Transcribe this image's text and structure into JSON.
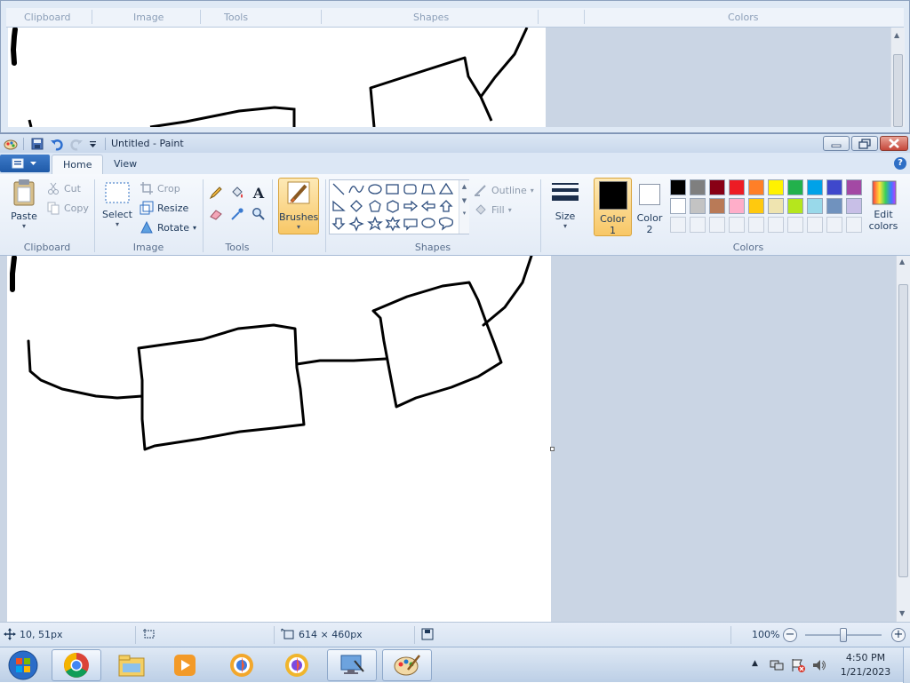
{
  "background_window": {
    "group_labels": [
      "Clipboard",
      "Image",
      "Tools",
      "Shapes",
      "Colors"
    ]
  },
  "window": {
    "title": "Untitled - Paint",
    "tabs": [
      "Home",
      "View"
    ],
    "help": "?"
  },
  "ribbon": {
    "clipboard": {
      "paste": "Paste",
      "cut": "Cut",
      "copy": "Copy",
      "label": "Clipboard"
    },
    "image": {
      "select": "Select",
      "crop": "Crop",
      "resize": "Resize",
      "rotate": "Rotate",
      "label": "Image"
    },
    "tools": {
      "label": "Tools",
      "text_tool": "A"
    },
    "brushes": {
      "label": "Brushes"
    },
    "shapes": {
      "outline": "Outline",
      "fill": "Fill",
      "label": "Shapes"
    },
    "size": {
      "label": "Size"
    },
    "color1": {
      "line1": "Color",
      "line2": "1",
      "value": "#000000"
    },
    "color2": {
      "line1": "Color",
      "line2": "2",
      "value": "#ffffff"
    },
    "colors": {
      "label": "Colors",
      "row1": [
        "#000000",
        "#7f7f7f",
        "#880015",
        "#ed1c24",
        "#ff7f27",
        "#fff200",
        "#22b14c",
        "#00a2e8",
        "#3f48cc",
        "#a349a4"
      ],
      "row2": [
        "#ffffff",
        "#c3c3c3",
        "#b97a57",
        "#ffaec9",
        "#ffc90e",
        "#efe4b0",
        "#b5e61d",
        "#99d9ea",
        "#7092be",
        "#c8bfe7"
      ],
      "edit_line1": "Edit",
      "edit_line2": "colors"
    }
  },
  "status": {
    "cursor_pos": "10, 51px",
    "selection_size": "",
    "image_size": "614 × 460px",
    "zoom": "100%",
    "zoom_level": 1.0
  },
  "taskbar": {
    "time": "4:50 PM",
    "date": "1/21/2023"
  },
  "icons": [
    "paint-app-icon",
    "save-icon",
    "undo-icon",
    "redo-icon",
    "qat-dropdown-icon",
    "minimize-icon",
    "maximize-icon",
    "close-icon",
    "file-menu-icon",
    "help-icon",
    "paste-icon",
    "cut-icon",
    "copy-icon",
    "select-icon",
    "crop-icon",
    "resize-icon",
    "rotate-icon",
    "pencil-icon",
    "fill-icon",
    "text-icon",
    "eraser-icon",
    "color-picker-icon",
    "magnifier-icon",
    "brush-icon",
    "outline-icon",
    "fill-shape-icon",
    "size-icon",
    "edit-colors-icon",
    "move-cursor-icon",
    "selection-icon",
    "image-size-icon",
    "disk-icon",
    "zoom-out-icon",
    "zoom-in-icon",
    "start-orb-icon",
    "chrome-icon",
    "file-explorer-icon",
    "media-player-icon",
    "browser-a-icon",
    "browser-b-icon",
    "remote-desktop-icon",
    "paint-taskbar-icon",
    "tray-arrow-icon",
    "network-icon",
    "action-center-icon",
    "volume-icon"
  ]
}
